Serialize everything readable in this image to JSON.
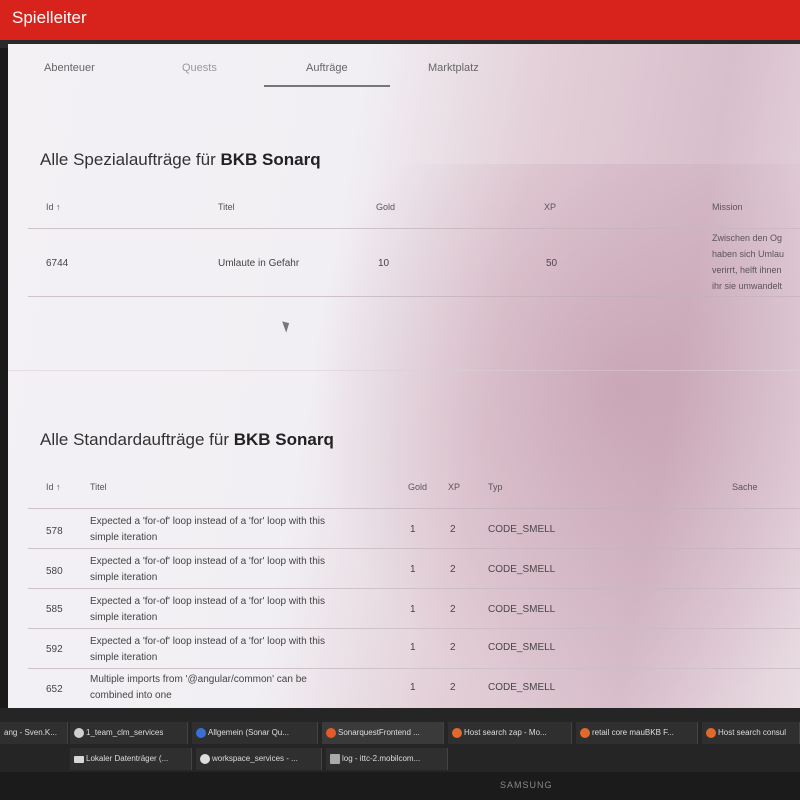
{
  "app": {
    "title": "Spielleiter"
  },
  "tabs": [
    "Abenteuer",
    "Quests",
    "Aufträge",
    "Marktplatz"
  ],
  "special": {
    "title_prefix": "Alle Spezialaufträge für ",
    "title_bold": "BKB Sonarq",
    "headers": {
      "id": "Id ↑",
      "titel": "Titel",
      "gold": "Gold",
      "xp": "XP",
      "mission": "Mission"
    },
    "row": {
      "id": "6744",
      "titel": "Umlaute in Gefahr",
      "gold": "10",
      "xp": "50",
      "mission": [
        "Zwischen den Og",
        "haben sich Umlau",
        "verirrt, helft ihnen",
        "ihr sie umwandelt"
      ]
    }
  },
  "standard": {
    "title_prefix": "Alle Standardaufträge für ",
    "title_bold": "BKB Sonarq",
    "headers": {
      "id": "Id ↑",
      "titel": "Titel",
      "gold": "Gold",
      "xp": "XP",
      "typ": "Typ",
      "sache": "Sache"
    },
    "rows": [
      {
        "id": "578",
        "titel1": "Expected a 'for-of' loop instead of a 'for' loop with this",
        "titel2": "simple iteration",
        "gold": "1",
        "xp": "2",
        "typ": "CODE_SMELL"
      },
      {
        "id": "580",
        "titel1": "Expected a 'for-of' loop instead of a 'for' loop with this",
        "titel2": "simple iteration",
        "gold": "1",
        "xp": "2",
        "typ": "CODE_SMELL"
      },
      {
        "id": "585",
        "titel1": "Expected a 'for-of' loop instead of a 'for' loop with this",
        "titel2": "simple iteration",
        "gold": "1",
        "xp": "2",
        "typ": "CODE_SMELL"
      },
      {
        "id": "592",
        "titel1": "Expected a 'for-of' loop instead of a 'for' loop with this",
        "titel2": "simple iteration",
        "gold": "1",
        "xp": "2",
        "typ": "CODE_SMELL"
      },
      {
        "id": "652",
        "titel1": "Multiple imports from '@angular/common' can be",
        "titel2": "combined into one",
        "gold": "1",
        "xp": "2",
        "typ": "CODE_SMELL"
      }
    ]
  },
  "taskbar": {
    "row1": [
      "ang - Sven.K...",
      "1_team_clm_services",
      "Allgemein (Sonar Qu...",
      "SonarquestFrontend ...",
      "Host search zap - Mo...",
      "retail core mauBKB F...",
      "Host search consul"
    ],
    "row2": [
      "Lokaler Datenträger (...",
      "workspace_services - ...",
      "log - ittc-2.mobilcom..."
    ],
    "icon_colors": [
      "#4a7fd1",
      "#cfcfcf",
      "#3b6fd6",
      "#e55a2b",
      "#e06a2c",
      "#e06a2c",
      "#e06a2c"
    ]
  },
  "monitor_brand": "SAMSUNG"
}
